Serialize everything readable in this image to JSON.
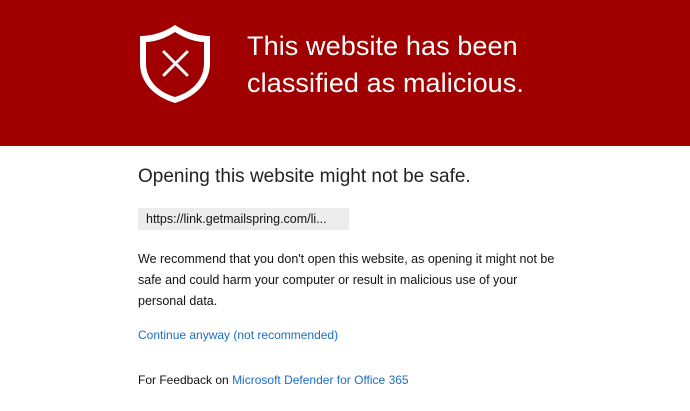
{
  "banner": {
    "title_line1": "This website has been",
    "title_line2": "classified as malicious.",
    "background_color": "#a00000",
    "icon": "shield-x-icon"
  },
  "main": {
    "heading": "Opening this website might not be safe.",
    "url": "https://link.getmailspring.com/li...",
    "recommendation": "We recommend that you don't open this website, as opening it might not be safe and could harm your computer or result in malicious use of your personal data.",
    "continue_link": "Continue anyway (not recommended)",
    "feedback_prefix": "For Feedback on ",
    "feedback_link": "Microsoft Defender for Office 365",
    "link_color": "#1a6fc2"
  }
}
